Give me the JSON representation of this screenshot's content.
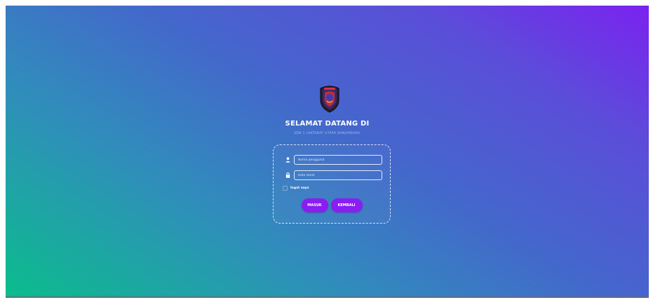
{
  "page": {
    "title": "SELAMAT DATANG DI",
    "subtitle": "SDN 1 LOKTABAT UTARA BANJARBARU"
  },
  "logo": {
    "icon": "school-emblem-icon"
  },
  "form": {
    "username": {
      "placeholder": "Nama pengguna",
      "value": "",
      "icon": "user-icon"
    },
    "password": {
      "placeholder": "Kata sandi",
      "value": "",
      "icon": "lock-icon"
    },
    "remember_label": "Ingat saya",
    "remember_checked": false,
    "submit_label": "MASUK",
    "back_label": "KEMBALI"
  },
  "colors": {
    "gradient_start": "#0bbd8c",
    "gradient_mid": "#4467cc",
    "gradient_end": "#7a22ef",
    "button": "#8a1df2"
  }
}
